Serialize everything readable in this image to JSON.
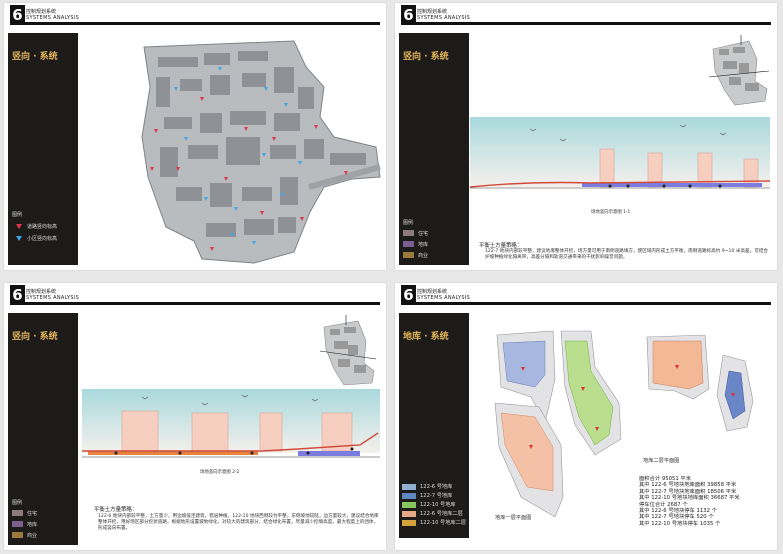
{
  "slides": [
    {
      "header": {
        "number": "6",
        "title_cn": "控制规划系统",
        "title_en": "SYSTEMS ANALYSIS"
      },
      "section_title": "竖向 · 系统",
      "legend": {
        "title": "图例",
        "items": [
          {
            "label": "道路竖向标高",
            "icon": "red-triangle-icon",
            "color": "#e0374a"
          },
          {
            "label": "小区竖向标高",
            "icon": "blue-triangle-icon",
            "color": "#43a6e0"
          }
        ]
      }
    },
    {
      "header": {
        "number": "6",
        "title_cn": "控制规划系统",
        "title_en": "SYSTEMS ANALYSIS"
      },
      "section_title": "竖向 · 系统",
      "legend": {
        "title": "图例",
        "items": [
          {
            "label": "住宅",
            "color": "#8c7b7b"
          },
          {
            "label": "地库",
            "color": "#7c5f8f"
          },
          {
            "label": "商业",
            "color": "#9c7a3c"
          }
        ]
      },
      "section_caption": "场地竖向示意图 1-1",
      "text_title": "平衡土方量策略：",
      "text_body": "122-7 地块内部较平整，建议地库整体开挖，场方量可用于南侧道路填方，使区域内形成土方平衡，南侧道路标高约 9~10 米高差，可结合护坡种植绿化隔离带，高差分隔和轨道交通带来的干扰影响噪音问题。"
    },
    {
      "header": {
        "number": "6",
        "title_cn": "控制规划系统",
        "title_en": "SYSTEMS ANALYSIS"
      },
      "section_title": "竖向 · 系统",
      "legend": {
        "title": "图例",
        "items": [
          {
            "label": "住宅",
            "color": "#8c7b7b"
          },
          {
            "label": "地库",
            "color": "#7c5f8f"
          },
          {
            "label": "商业",
            "color": "#9c7a3c"
          }
        ]
      },
      "section_caption": "场地竖向示意图 2-2",
      "text_title": "平衡土方量策略：",
      "text_body": "122-6 地块内部较平整，土方量少，用边坡低洼建筑，错层种植。122-10 地块西侧较为平整，东侧坡地较陡，边方量较大，建议结合地库整体开挖，用好场区部分挖状道路，根据地形设置坡地绿化、对较大的建筑部分，结合绿化布置，尽量减少挖填高度，最大程度上的团体，形成竖向布置。"
    },
    {
      "header": {
        "number": "6",
        "title_cn": "控制规划系统",
        "title_en": "SYSTEMS ANALYSIS"
      },
      "section_title": "地库 · 系统",
      "legend": {
        "items": [
          {
            "label": "122-6 号地库",
            "color": "#8fb0d2"
          },
          {
            "label": "122-7 号地库",
            "color": "#5f87c2"
          },
          {
            "label": "122-10 号地库",
            "color": "#86c65c"
          },
          {
            "label": "122-6 号地库二层",
            "color": "#e4a985"
          },
          {
            "label": "122-10 号地库二层",
            "color": "#d5a43e"
          }
        ]
      },
      "caption_level1": "地库一层平面图",
      "caption_level2": "地库二层平面图",
      "stats": [
        "面积合计 95051 平米",
        "其中 122-6 号地块地库面积 39858 平米",
        "其中 122-7 号地块地库面积 18506 平米",
        "其中 122-10 号地块地库面积 36687 平米",
        "停车位合计 2687 个",
        "其中 122-6 号地块停车 1132 个",
        "其中 122-7 号地块停车 520 个",
        "其中 122-10 号地块停车 1035 个"
      ]
    }
  ]
}
